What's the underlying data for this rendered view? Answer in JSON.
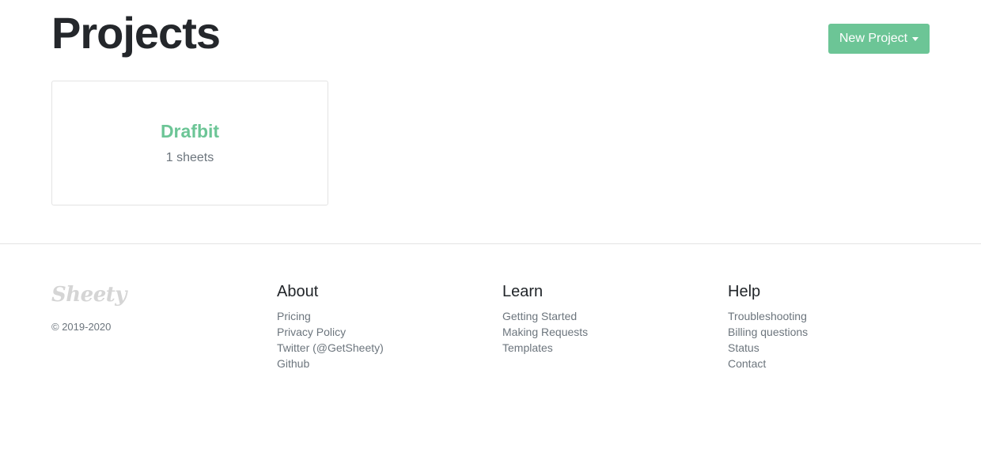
{
  "header": {
    "title": "Projects",
    "new_project_label": "New Project"
  },
  "projects": [
    {
      "name": "Drafbit",
      "sheets": "1 sheets"
    }
  ],
  "footer": {
    "brand": "Sheety",
    "copyright": "© 2019-2020",
    "about": {
      "heading": "About",
      "links": [
        "Pricing",
        "Privacy Policy",
        "Twitter (@GetSheety)",
        "Github"
      ]
    },
    "learn": {
      "heading": "Learn",
      "links": [
        "Getting Started",
        "Making Requests",
        "Templates"
      ]
    },
    "help": {
      "heading": "Help",
      "links": [
        "Troubleshooting",
        "Billing questions",
        "Status",
        "Contact"
      ]
    }
  },
  "colors": {
    "accent": "#6cc596",
    "muted_text": "#6c757d",
    "border": "#e3e3e3"
  },
  "icons": {
    "dropdown": "caret-down-icon"
  }
}
